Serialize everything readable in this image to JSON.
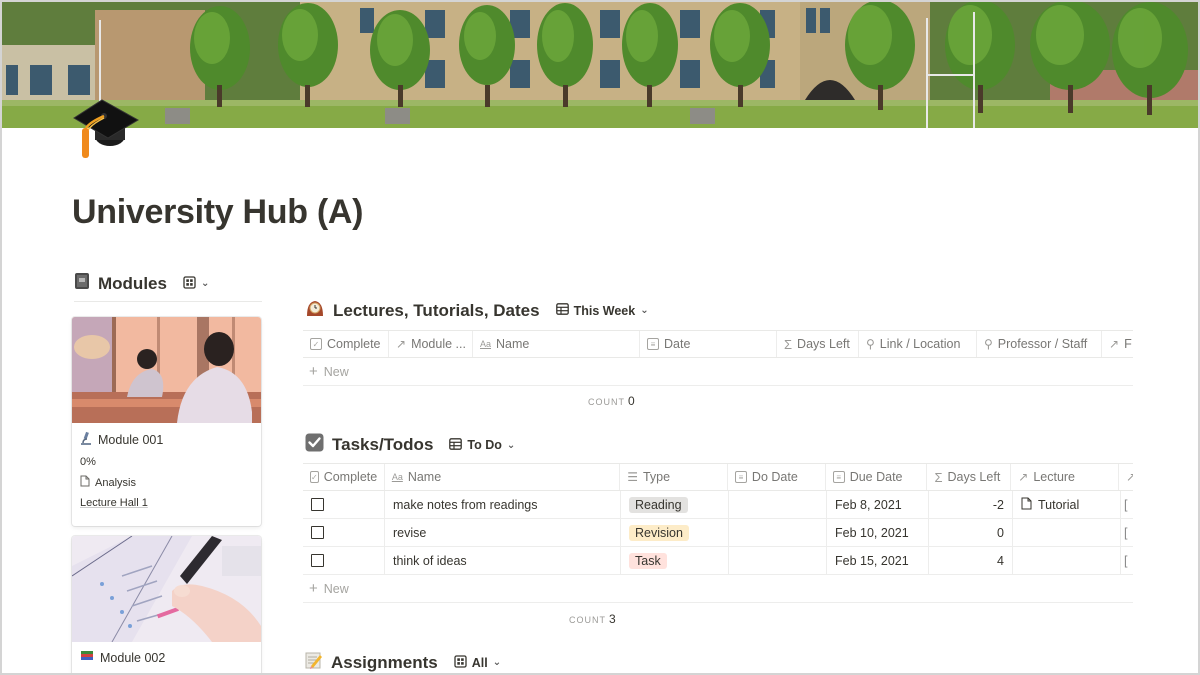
{
  "page": {
    "title": "University Hub (A)",
    "icon": "graduation-cap-icon"
  },
  "modules": {
    "icon": "notebook-icon",
    "title": "Modules",
    "view_icon": "gallery-icon",
    "cards": [
      {
        "icon": "microscope-icon",
        "name": "Module 001",
        "progress": "0%",
        "relation": "Analysis",
        "location": "Lecture Hall 1"
      },
      {
        "icon": "books-icon",
        "name": "Module 002"
      }
    ]
  },
  "lectures": {
    "icon": "mantelpiece-clock-icon",
    "title": "Lectures, Tutorials, Dates",
    "view_label": "This Week",
    "columns": [
      {
        "icon": "checkbox-icon",
        "label": "Complete"
      },
      {
        "icon": "relation-arrow-icon",
        "label": "Module ..."
      },
      {
        "icon": "title-aa-icon",
        "label": "Name"
      },
      {
        "icon": "calendar-icon",
        "label": "Date"
      },
      {
        "icon": "sigma-icon",
        "label": "Days Left"
      },
      {
        "icon": "search-icon",
        "label": "Link / Location"
      },
      {
        "icon": "search-icon",
        "label": "Professor / Staff"
      },
      {
        "icon": "relation-arrow-icon",
        "label": "F"
      }
    ],
    "new_label": "New",
    "count_label": "COUNT",
    "count_value": "0"
  },
  "tasks": {
    "icon": "check-box-icon",
    "title": "Tasks/Todos",
    "view_label": "To Do",
    "columns": [
      {
        "icon": "checkbox-icon",
        "label": "Complete"
      },
      {
        "icon": "title-aa-icon",
        "label": "Name"
      },
      {
        "icon": "list-icon",
        "label": "Type"
      },
      {
        "icon": "calendar-icon",
        "label": "Do Date"
      },
      {
        "icon": "calendar-icon",
        "label": "Due Date"
      },
      {
        "icon": "sigma-icon",
        "label": "Days Left"
      },
      {
        "icon": "relation-arrow-icon",
        "label": "Lecture"
      },
      {
        "icon": "relation-arrow-icon",
        "label": ""
      }
    ],
    "rows": [
      {
        "complete": false,
        "name": "make notes from readings",
        "type": "Reading",
        "type_bg": "#e3e2e0",
        "do_date": "",
        "due_date": "Feb 8, 2021",
        "days_left": "-2",
        "lecture": "Tutorial",
        "extra": "["
      },
      {
        "complete": false,
        "name": "revise",
        "type": "Revision",
        "type_bg": "#fdecc8",
        "do_date": "",
        "due_date": "Feb 10, 2021",
        "days_left": "0",
        "lecture": "",
        "extra": "["
      },
      {
        "complete": false,
        "name": "think of ideas",
        "type": "Task",
        "type_bg": "#ffe2dd",
        "do_date": "",
        "due_date": "Feb 15, 2021",
        "days_left": "4",
        "lecture": "",
        "extra": "["
      }
    ],
    "new_label": "New",
    "count_label": "COUNT",
    "count_value": "3"
  },
  "assignments": {
    "icon": "memo-icon",
    "title": "Assignments",
    "view_label": "All"
  }
}
